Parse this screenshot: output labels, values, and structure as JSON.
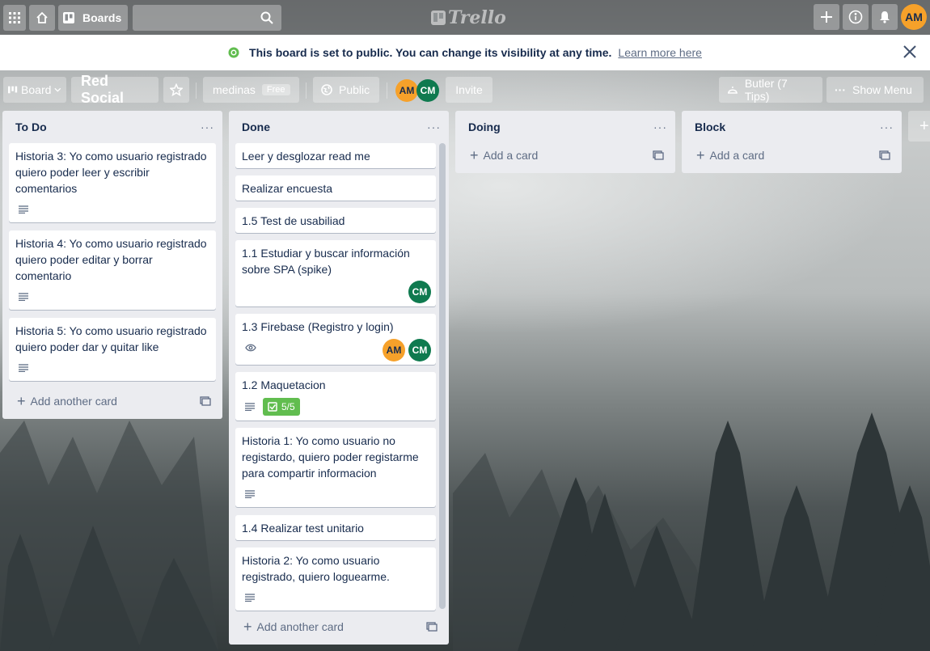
{
  "header": {
    "boards_label": "Boards",
    "logo_text": "Trello",
    "user_initials": "AM",
    "icons": [
      "apps-grid-icon",
      "home-icon",
      "boards-icon",
      "search-icon",
      "plus-icon",
      "info-icon",
      "bell-icon"
    ]
  },
  "banner": {
    "message": "This board is set to public. You can change its visibility at any time.",
    "link": "Learn more here"
  },
  "boardbar": {
    "board_menu": "Board",
    "board_name": "Red Social",
    "team": "medinas",
    "team_badge": "Free",
    "visibility": "Public",
    "members": [
      "AM",
      "CM"
    ],
    "invite": "Invite",
    "butler": "Butler (7 Tips)",
    "show_menu": "Show Menu"
  },
  "lists": [
    {
      "title": "To Do",
      "cards": [
        {
          "title": "Historia 3: Yo como usuario registrado quiero poder leer y escribir comentarios"
        },
        {
          "title": "Historia 4: Yo como usuario registrado quiero poder editar y borrar comentario"
        },
        {
          "title": "Historia 5: Yo como usuario registrado quiero poder dar y quitar like"
        }
      ],
      "add_label": "Add another card"
    },
    {
      "title": "Done",
      "cards": [
        {
          "title": "Leer y desglozar read me"
        },
        {
          "title": "Realizar encuesta"
        },
        {
          "title": "1.5 Test de usabiliad"
        },
        {
          "title": "1.1 Estudiar y buscar información sobre SPA (spike)",
          "members": [
            "CM"
          ]
        },
        {
          "title": "1.3 Firebase (Registro y login)",
          "members": [
            "AM",
            "CM"
          ]
        },
        {
          "title": "1.2 Maquetacion",
          "checklist": "5/5"
        },
        {
          "title": "Historia 1: Yo como usuario no registardo, quiero poder registarme para compartir informacion"
        },
        {
          "title": "1.4 Realizar test unitario"
        },
        {
          "title": "Historia 2: Yo como usuario registrado, quiero loguearme."
        }
      ],
      "add_label": "Add another card"
    },
    {
      "title": "Doing",
      "cards": [],
      "add_label": "Add a card"
    },
    {
      "title": "Block",
      "cards": [],
      "add_label": "Add a card"
    }
  ],
  "colors": {
    "am_avatar": "#f6a12a",
    "cm_avatar": "#0f7a4f",
    "checklist_complete": "#61bd4f",
    "list_bg": "#ebecf0"
  }
}
